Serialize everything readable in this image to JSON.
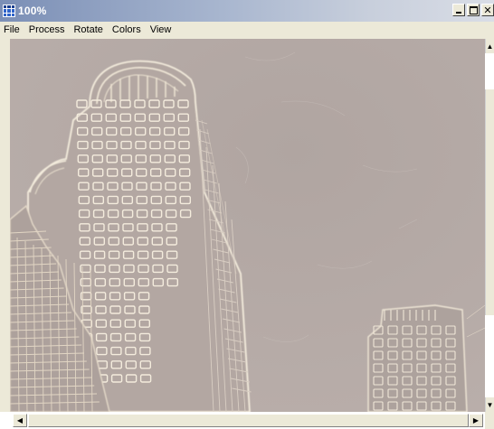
{
  "window": {
    "title": "100%",
    "icon": "grid-app-icon",
    "title_buttons": [
      "minimize",
      "maximize",
      "close"
    ]
  },
  "menu": {
    "items": [
      {
        "label": "File"
      },
      {
        "label": "Process"
      },
      {
        "label": "Rotate"
      },
      {
        "label": "Colors"
      },
      {
        "label": "View"
      }
    ]
  },
  "image": {
    "description_icon": "edge-detected-skyscraper-image",
    "background_color": "#b5aaa6",
    "edge_color": "#efe6d6"
  },
  "scrollbars": {
    "vertical_arrows": [
      "arrow-up-icon",
      "arrow-down-icon"
    ],
    "horizontal_arrows": [
      "arrow-left-icon",
      "arrow-right-icon"
    ]
  },
  "colors": {
    "titlebar_start": "#7b8fb6",
    "titlebar_end": "#d9dde6",
    "chrome": "#ece9d8"
  }
}
